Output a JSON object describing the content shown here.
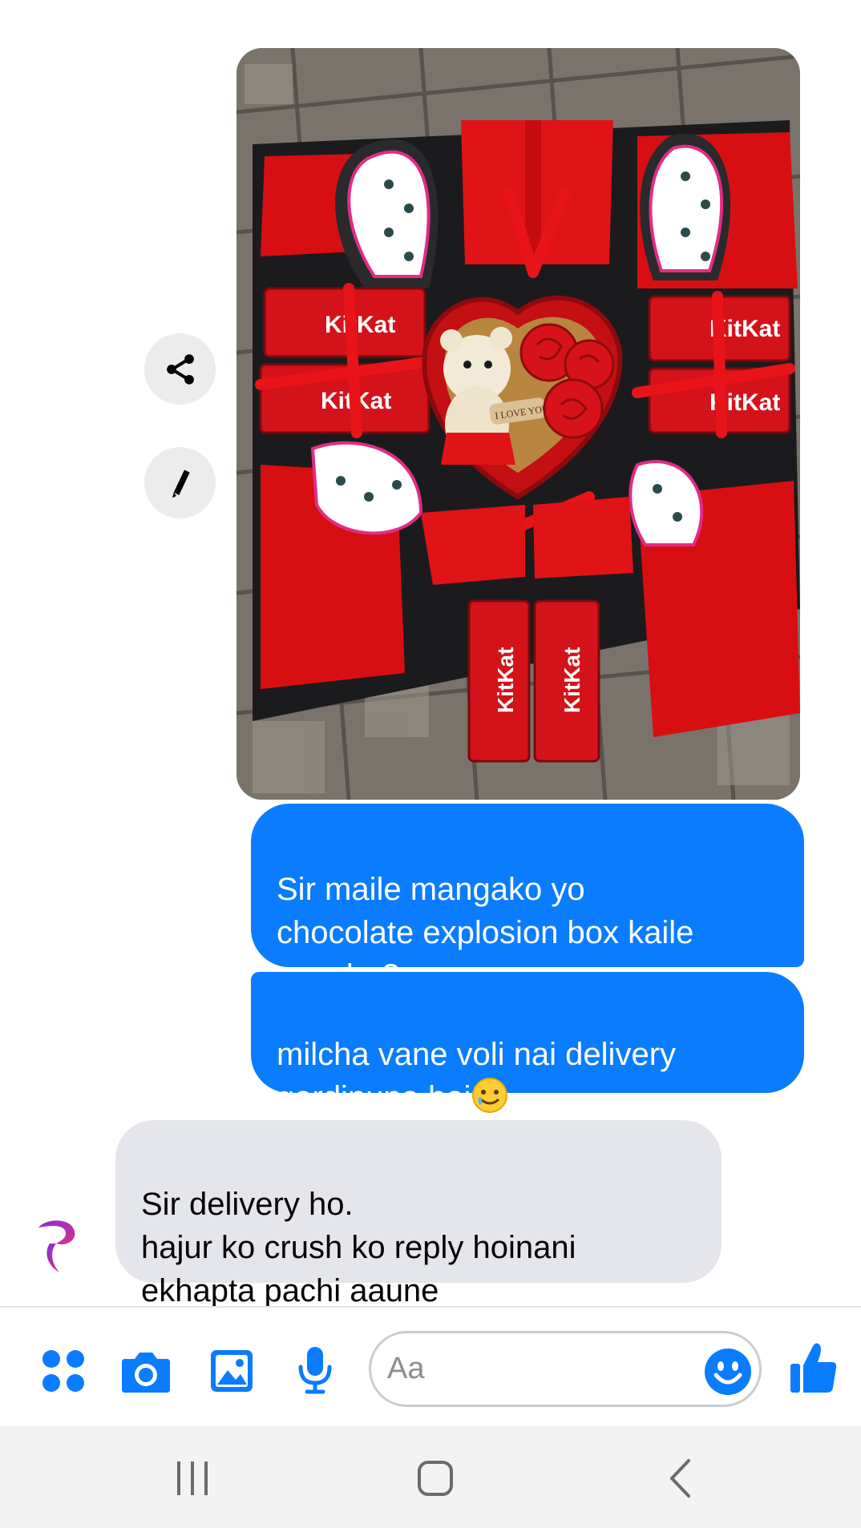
{
  "conversation": {
    "photo_message": {
      "description_icon": "gift-box-photo",
      "printed_labels": {
        "teddy_tag": "I LOVE YOU",
        "chocolate_brand": "KitKat"
      }
    },
    "actions": {
      "share_icon": "share-icon",
      "edit_icon": "pencil-icon"
    },
    "messages": [
      {
        "direction": "outgoing",
        "text": "Sir maile mangako yo\nchocolate explosion box kaile\naaucha?"
      },
      {
        "direction": "outgoing",
        "text": "milcha vane voli nai delivery\ngardinuna hoi",
        "trailing_emoji": "🥲"
      },
      {
        "direction": "incoming",
        "text": "Sir delivery ho.\nhajur ko crush ko reply hoinani\nekhapta pachi aaune"
      }
    ]
  },
  "composer": {
    "placeholder": "Aa",
    "value": "",
    "icons": [
      "apps-icon",
      "camera-icon",
      "gallery-icon",
      "microphone-icon",
      "emoji-icon",
      "thumbs-up-icon"
    ]
  },
  "navigation_bar": {
    "icons": [
      "recents-icon",
      "home-icon",
      "back-icon"
    ]
  },
  "colors": {
    "outgoing_bubble": "#0a7cff",
    "incoming_bubble": "#e4e6eb",
    "accent": "#0a7cff",
    "nav_bar": "#f3f3f3"
  }
}
